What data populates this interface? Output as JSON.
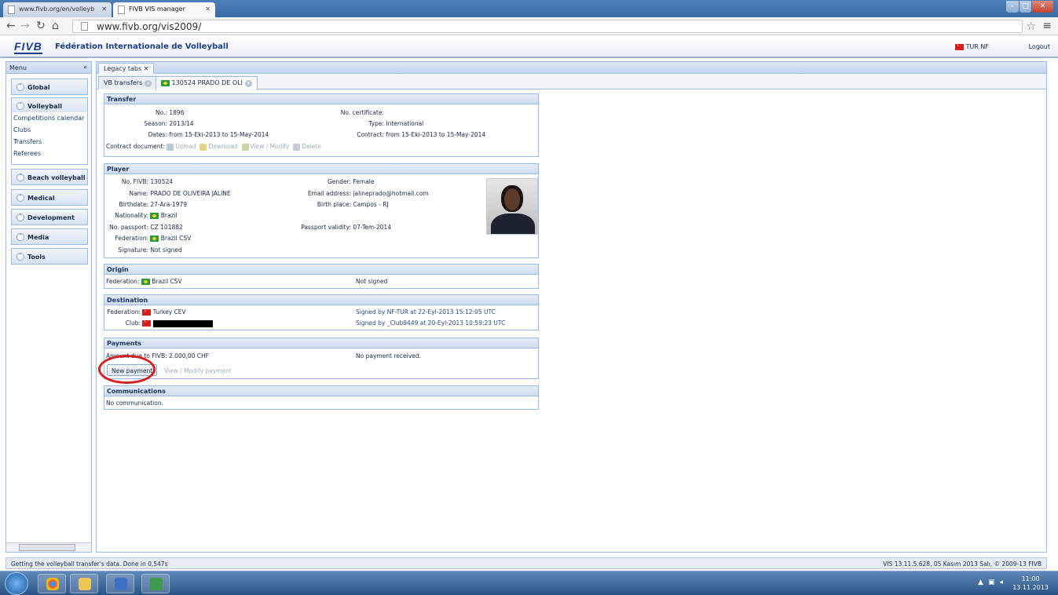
{
  "browser": {
    "tabs": [
      {
        "label": "www.fivb.org/en/volleyb"
      },
      {
        "label": "FIVB VIS manager"
      }
    ],
    "url": "www.fivb.org/vis2009/"
  },
  "header": {
    "logo": "FIVB",
    "org_name": "Fédération Internationale de Volleyball",
    "user": "TUR NF",
    "logout": "Logout"
  },
  "menu": {
    "title": "Menu",
    "sections": [
      "Global",
      "Volleyball",
      "Beach volleyball",
      "Medical",
      "Development",
      "Media",
      "Tools"
    ],
    "volleyball_items": [
      "Competitions calendar",
      "Clubs",
      "Transfers",
      "Referees"
    ]
  },
  "tabs": {
    "legacy": "Legacy tabs",
    "inner": [
      "VB transfers",
      "130524 PRADO DE OLI"
    ]
  },
  "transfer": {
    "title": "Transfer",
    "no_label": "No.:",
    "no": "1896",
    "season_label": "Season:",
    "season": "2013/14",
    "dates_label": "Dates:",
    "dates": "from 15-Eki-2013   to 15-May-2014",
    "cert_label": "No. certificate:",
    "cert": "",
    "type_label": "Type:",
    "type": "International",
    "contract_label": "Contract:",
    "contract": "from 15-Eki-2013   to 15-May-2014",
    "doc_label": "Contract document:",
    "upload": "Upload",
    "download": "Download",
    "view_modify": "View / Modify",
    "delete": "Delete"
  },
  "player": {
    "title": "Player",
    "fivb_label": "No. FIVB:",
    "fivb": "130524",
    "name_label": "Name:",
    "name": "PRADO DE OLIVEIRA JALINE",
    "birthdate_label": "Birthdate:",
    "birthdate": "27-Ara-1979",
    "nationality_label": "Nationality:",
    "nationality": "Brazil",
    "passport_label": "No. passport:",
    "passport": "CZ 101882",
    "federation_label": "Federation:",
    "federation": "Brazil  CSV",
    "signature_label": "Signature:",
    "signature": "Not signed",
    "gender_label": "Gender:",
    "gender": "Female",
    "email_label": "Email address:",
    "email": "jalineprado@hotmail.com",
    "birthplace_label": "Birth place:",
    "birthplace": "Campos - RJ",
    "passport_validity_label": "Passport validity:",
    "passport_validity": "07-Tem-2014"
  },
  "origin": {
    "title": "Origin",
    "federation_label": "Federation:",
    "federation": "Brazil  CSV",
    "status": "Not signed"
  },
  "destination": {
    "title": "Destination",
    "federation_label": "Federation:",
    "federation": "Turkey  CEV",
    "club_label": "Club:",
    "signed_nf": "Signed by NF-TUR at 22-Eyl-2013 15:12:05 UTC",
    "signed_club": "Signed by _Club9449 at 20-Eyl-2013 10:59:23 UTC"
  },
  "payments": {
    "title": "Payments",
    "amount_label": "Amount due to FIVB:",
    "amount": "2.000,00 CHF",
    "status": "No payment received.",
    "new_payment": "New payment",
    "view_modify": "View / Modify payment"
  },
  "communications": {
    "title": "Communications",
    "text": "No communication."
  },
  "status": {
    "left": "Getting the volleyball transfer's data. Done in 0,547s",
    "right": "VIS 13.11.5.628, 05 Kasım 2013 Salı, © 2009-13 FIVB"
  },
  "taskbar": {
    "time": "11:00",
    "date": "13.11.2013"
  },
  "colors": {
    "accent": "#1f3e8a",
    "panel_border": "#99bbe8",
    "highlight": "#d42020"
  }
}
